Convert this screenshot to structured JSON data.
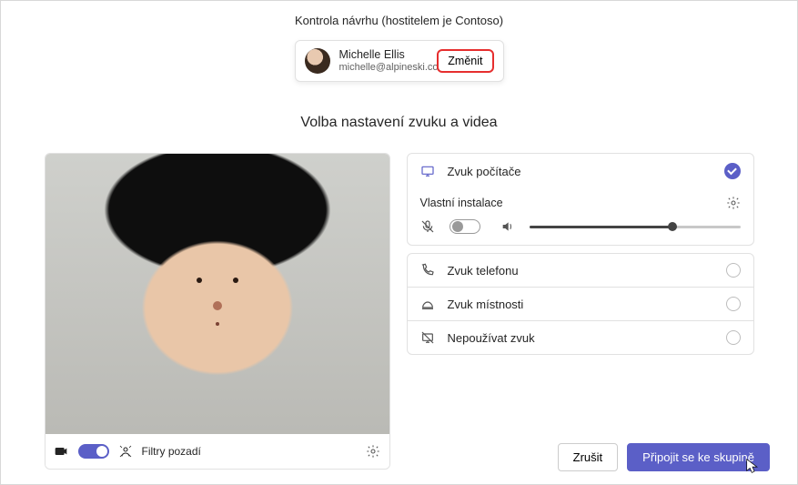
{
  "title": "Kontrola návrhu (hostitelem je Contoso)",
  "identity": {
    "name": "Michelle Ellis",
    "email": "michelle@alpineski.com",
    "change_label": "Změnit"
  },
  "subtitle": "Volba nastavení zvuku a videa",
  "video_bar": {
    "filters_label": "Filtry pozadí",
    "camera_on": true
  },
  "audio": {
    "selected": "computer",
    "computer": {
      "label": "Zvuk počítače"
    },
    "custom_setup_label": "Vlastní instalace",
    "mic_muted": true,
    "volume_percent": 68,
    "phone": {
      "label": "Zvuk telefonu"
    },
    "room": {
      "label": "Zvuk místnosti"
    },
    "none": {
      "label": "Nepoužívat zvuk"
    }
  },
  "footer": {
    "cancel_label": "Zrušit",
    "join_label": "Připojit se ke skupině"
  },
  "colors": {
    "accent": "#5b5fc7",
    "highlight_border": "#e62e2e"
  }
}
